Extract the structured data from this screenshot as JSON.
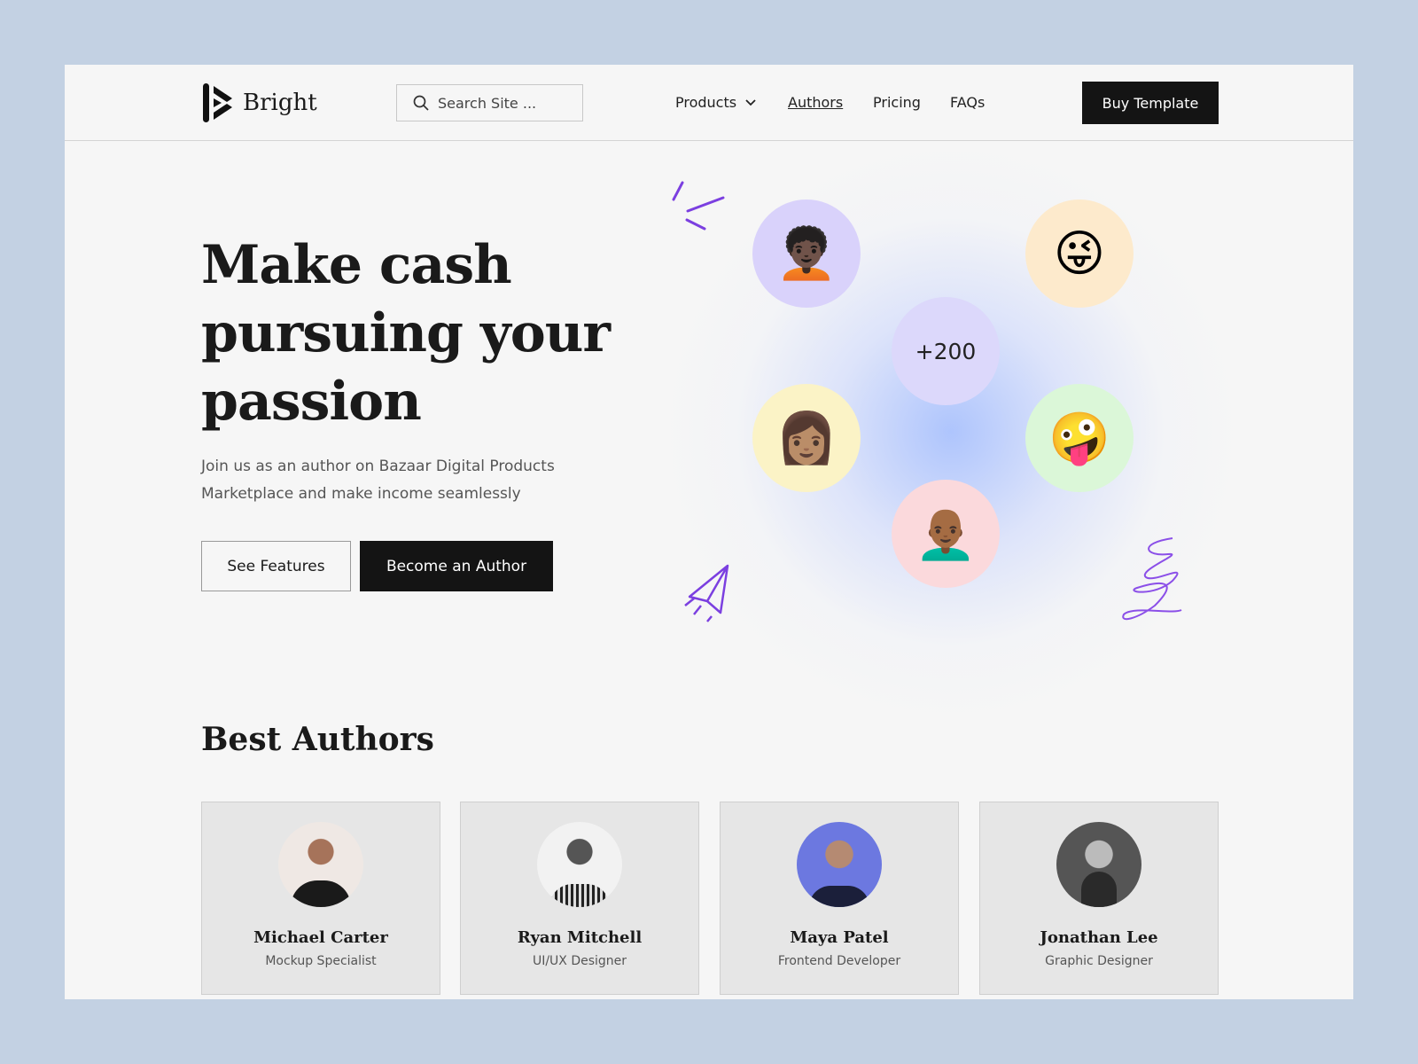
{
  "brand": {
    "name": "Bright"
  },
  "search": {
    "placeholder": "Search Site ..."
  },
  "nav": {
    "items": [
      {
        "label": "Products"
      },
      {
        "label": "Authors"
      },
      {
        "label": "Pricing"
      },
      {
        "label": "FAQs"
      }
    ],
    "buy_label": "Buy Template"
  },
  "hero": {
    "title": "Make cash pursuing your passion",
    "subtitle": "Join us as an author on Bazaar Digital Products Marketplace and make income seamlessly",
    "see_features": "See Features",
    "become_author": "Become an Author",
    "count_badge": "+200"
  },
  "authors": {
    "heading": "Best Authors",
    "items": [
      {
        "name": "Michael Carter",
        "role": "Mockup Specialist"
      },
      {
        "name": "Ryan Mitchell",
        "role": "UI/UX Designer"
      },
      {
        "name": "Maya Patel",
        "role": "Frontend Developer"
      },
      {
        "name": "Jonathan Lee",
        "role": "Graphic Designer"
      }
    ]
  },
  "colors": {
    "accent": "#141414",
    "doodle": "#7b3fe0",
    "background": "#c3d1e3"
  }
}
